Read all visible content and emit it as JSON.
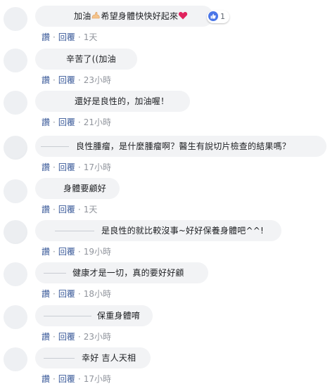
{
  "labels": {
    "like": "讚",
    "reply": "回覆",
    "sep": "·"
  },
  "comments": [
    {
      "text_before": "加油",
      "emoji": "flexed-biceps-icon",
      "text_after": "希望身體快快好起來",
      "emoji_end": "red-heart-icon",
      "reactions": "1",
      "time": "1天"
    },
    {
      "text": "辛苦了((加油",
      "time": "23小時"
    },
    {
      "text": "還好是良性的，加油喔！",
      "time": "21小時"
    },
    {
      "text": "良性腫瘤，是什麼腫瘤啊？醫生有說切片檢查的結果嗎？",
      "time": "17小時"
    },
    {
      "text": "身體要顧好",
      "time": "1天"
    },
    {
      "text": "是良性的就比較沒事~好好保養身體吧^^!",
      "time": "19小時"
    },
    {
      "text": "健康才是一切，真的要好好顧",
      "time": "18小時"
    },
    {
      "text": "保重身體唷",
      "time": "23小時"
    },
    {
      "text": "幸好 吉人天相",
      "time": "17小時"
    }
  ],
  "colors": {
    "bubble": "#f2f3f5",
    "link": "#385898",
    "muted": "#90949c",
    "like_blue": "#4a76e8"
  }
}
